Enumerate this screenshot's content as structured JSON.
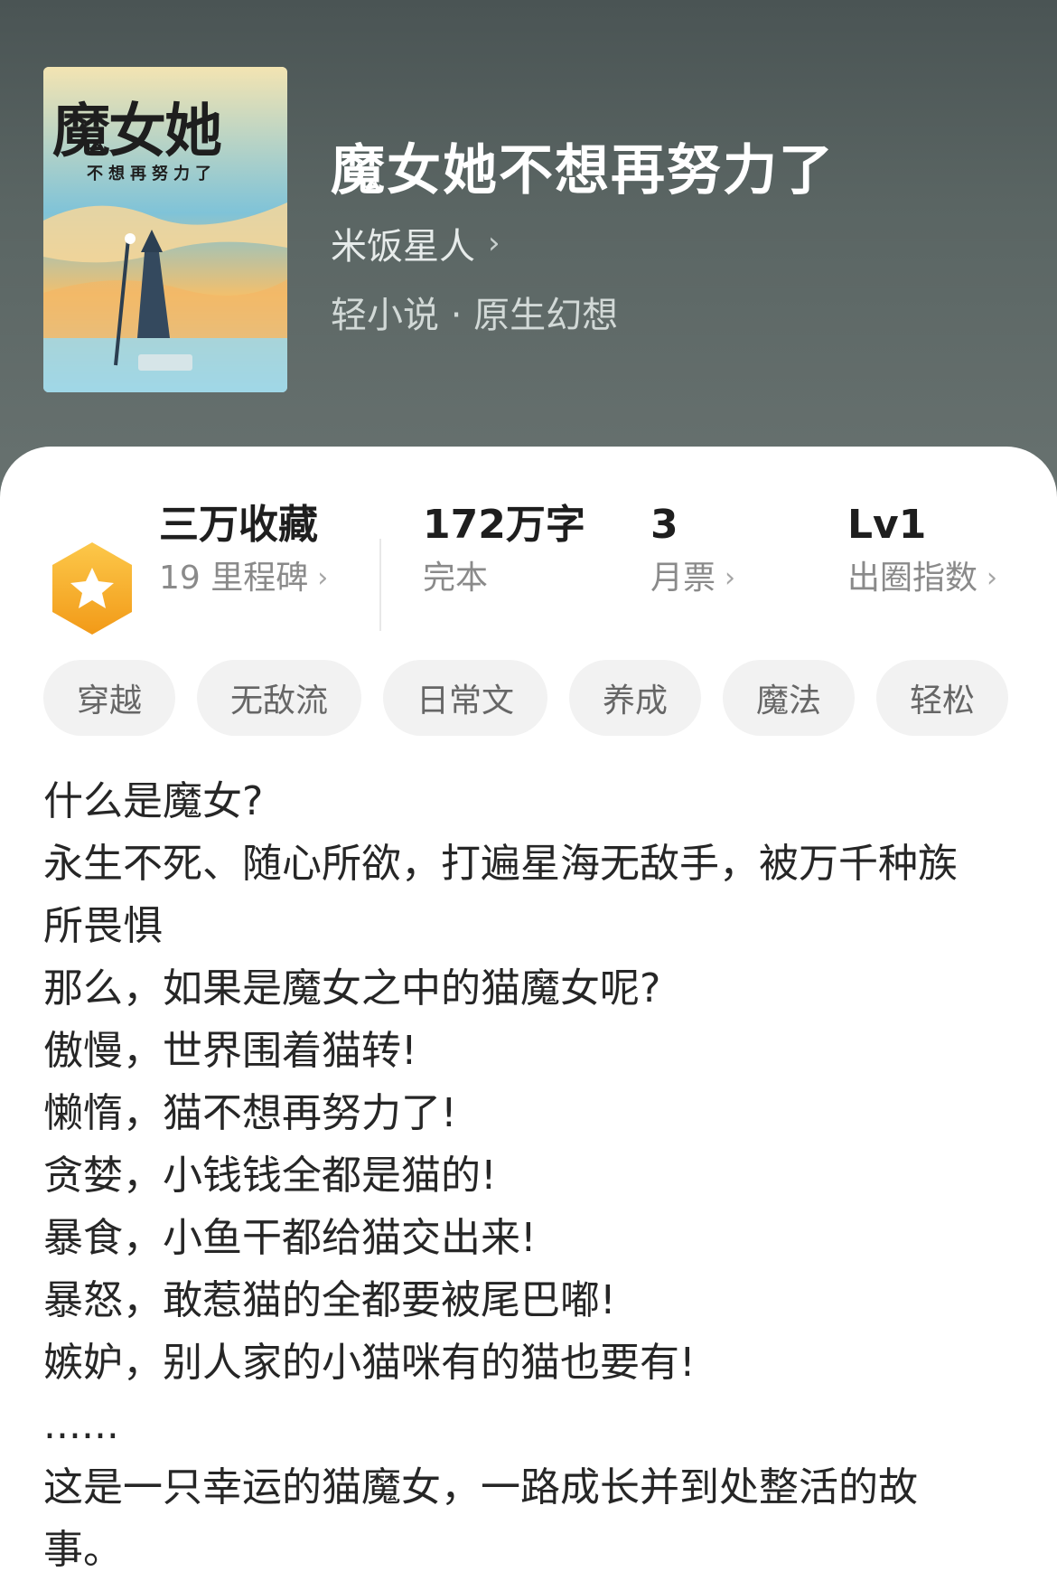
{
  "book": {
    "title": "魔女她不想再努力了",
    "author": "米饭星人",
    "genre": "轻小说 · 原生幻想",
    "cover_title": "魔女她",
    "cover_subtitle": "不想再努力了"
  },
  "stats": {
    "collection": {
      "main": "三万收藏",
      "sub": "19 里程碑"
    },
    "words": {
      "main": "172万字",
      "sub": "完本"
    },
    "tickets": {
      "main": "3",
      "sub": "月票"
    },
    "level": {
      "main": "Lv1",
      "sub": "出圈指数"
    }
  },
  "tags": [
    "穿越",
    "无敌流",
    "日常文",
    "养成",
    "魔法",
    "轻松"
  ],
  "description": [
    "什么是魔女?",
    "永生不死、随心所欲，打遍星海无敌手，被万千种族",
    "所畏惧",
    "那么，如果是魔女之中的猫魔女呢?",
    "傲慢，世界围着猫转!",
    "懒惰，猫不想再努力了!",
    "贪婪，小钱钱全都是猫的!",
    "暴食，小鱼干都给猫交出来!",
    "暴怒，敢惹猫的全都要被尾巴嘟!",
    "嫉妒，别人家的小猫咪有的猫也要有!",
    "......",
    "这是一只幸运的猫魔女，一路成长并到处整活的故",
    "事。"
  ],
  "colors": {
    "header_bg": "#5a6563",
    "badge_orange": "#f5a623",
    "text_dark": "#1e1e1e",
    "text_gray": "#8a8a8a",
    "tag_bg": "#f2f2f2"
  },
  "icons": {
    "badge": "hexagon-star-icon",
    "chevron": "chevron-right-icon"
  }
}
